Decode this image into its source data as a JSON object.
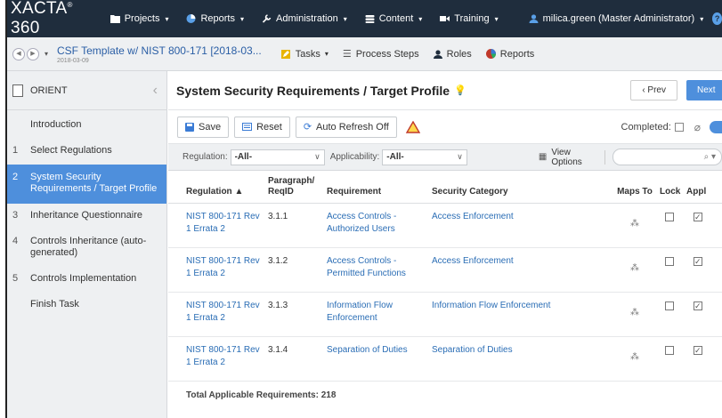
{
  "app": {
    "logo_text": "XACTA",
    "logo_suffix": "360",
    "logo_mark": "®"
  },
  "topnav": {
    "items": [
      {
        "label": "Projects",
        "icon": "folder-icon"
      },
      {
        "label": "Reports",
        "icon": "pie-chart-icon"
      },
      {
        "label": "Administration",
        "icon": "wrench-icon"
      },
      {
        "label": "Content",
        "icon": "database-icon"
      },
      {
        "label": "Training",
        "icon": "video-camera-icon"
      }
    ],
    "user_label": "milica.green (Master Administrator)",
    "help_label": "?"
  },
  "context": {
    "title": "CSF Template w/ NIST 800-171 [2018-03...",
    "date": "2018-03-09",
    "links": {
      "tasks": "Tasks",
      "process_steps": "Process Steps",
      "roles": "Roles",
      "reports": "Reports"
    }
  },
  "sidebar": {
    "header": "ORIENT",
    "items": [
      {
        "num": "",
        "label": "Introduction"
      },
      {
        "num": "1",
        "label": "Select Regulations"
      },
      {
        "num": "2",
        "label": "System Security Requirements / Target Profile"
      },
      {
        "num": "3",
        "label": "Inheritance Questionnaire"
      },
      {
        "num": "4",
        "label": "Controls Inheritance (auto-generated)"
      },
      {
        "num": "5",
        "label": "Controls Implementation"
      },
      {
        "num": "",
        "label": "Finish Task"
      }
    ],
    "active_index": 2
  },
  "main": {
    "title": "System Security Requirements / Target Profile",
    "prev_label": "‹ Prev",
    "next_label": "Next"
  },
  "toolbar": {
    "save": "Save",
    "reset": "Reset",
    "auto_refresh": "Auto Refresh Off",
    "completed_label": "Completed:"
  },
  "filters": {
    "regulation_label": "Regulation:",
    "regulation_value": "-All-",
    "applicability_label": "Applicability:",
    "applicability_value": "-All-",
    "view_options": "View Options"
  },
  "table": {
    "headers": {
      "regulation": "Regulation ▲",
      "paragraph": "Paragraph/ ReqID",
      "requirement": "Requirement",
      "security_category": "Security Category",
      "maps_to": "Maps To",
      "lock": "Lock",
      "appl": "Appl"
    },
    "rows": [
      {
        "regulation": "NIST 800-171 Rev 1 Errata 2",
        "paragraph": "3.1.1",
        "requirement": "Access Controls - Authorized Users",
        "security_category": "Access Enforcement",
        "lock": false,
        "appl": true
      },
      {
        "regulation": "NIST 800-171 Rev 1 Errata 2",
        "paragraph": "3.1.2",
        "requirement": "Access Controls - Permitted Functions",
        "security_category": "Access Enforcement",
        "lock": false,
        "appl": true
      },
      {
        "regulation": "NIST 800-171 Rev 1 Errata 2",
        "paragraph": "3.1.3",
        "requirement": "Information Flow Enforcement",
        "security_category": "Information Flow Enforcement",
        "lock": false,
        "appl": true
      },
      {
        "regulation": "NIST 800-171 Rev 1 Errata 2",
        "paragraph": "3.1.4",
        "requirement": "Separation of Duties",
        "security_category": "Separation of Duties",
        "lock": false,
        "appl": true
      }
    ],
    "total_label": "Total Applicable Requirements: 218"
  },
  "colors": {
    "nav_bg": "#1f2d3d",
    "accent": "#4e8fdc",
    "link": "#2a6db5",
    "warning": "#e8b400"
  }
}
